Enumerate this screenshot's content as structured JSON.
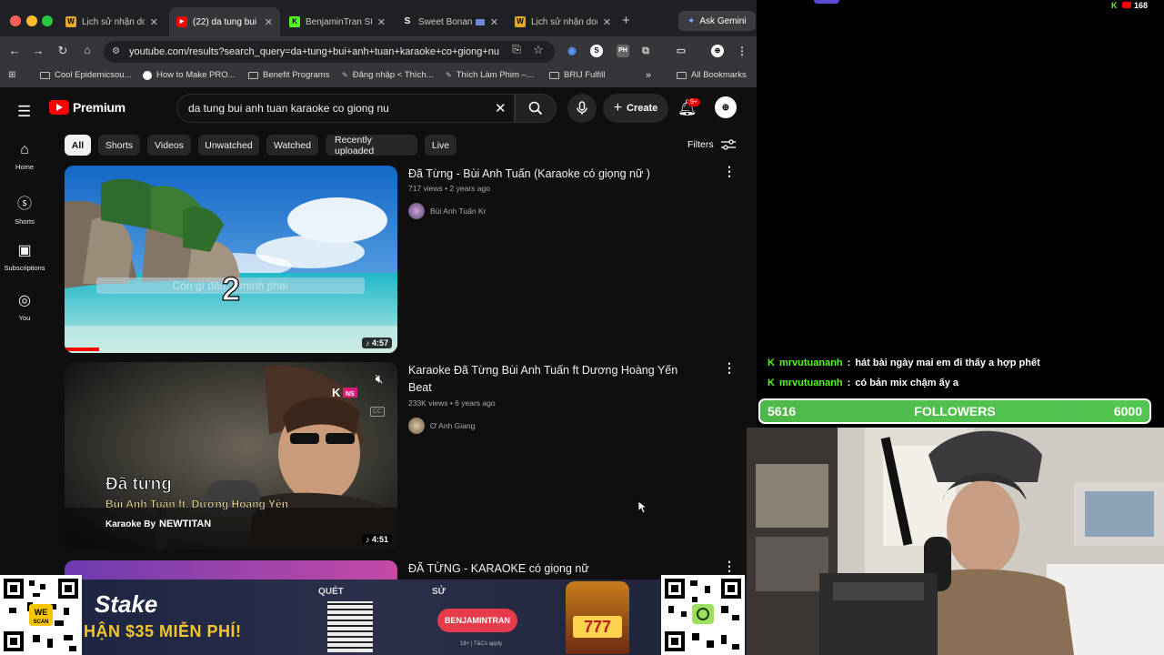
{
  "tabs": [
    {
      "label": "Lịch sử nhận don",
      "fav": "W",
      "fav_color": "#e3a72f"
    },
    {
      "label": "(22) da tung bui",
      "fav": "▶",
      "fav_color": "#ff0000"
    },
    {
      "label": "BenjaminTran St",
      "fav": "K",
      "fav_color": "#53fc18"
    },
    {
      "label": "Sweet Bonan",
      "fav": "S",
      "fav_color": "#202124"
    },
    {
      "label": "Lịch sử nhận don",
      "fav": "W",
      "fav_color": "#e3a72f"
    }
  ],
  "gemini": "Ask Gemini",
  "url": "youtube.com/results?search_query=da+tung+bui+anh+tuan+karaoke+co+giong+nu",
  "bookmarks": [
    "Cool Epidemicsou...",
    "How to Make PRO...",
    "Benefit Programs",
    "Đăng nhập < Thích...",
    "Thích Làm Phim –...",
    "BRIJ Fulfill",
    "All Bookmarks"
  ],
  "yt": {
    "logo_text": "Premium",
    "search_value": "da tung bui anh tuan karaoke co giong nu",
    "create": "Create",
    "badge": "9+",
    "sidebar": [
      "Home",
      "Shorts",
      "Subscriptions",
      "You"
    ],
    "chips": [
      "All",
      "Shorts",
      "Videos",
      "Unwatched",
      "Watched",
      "Recently uploaded",
      "Live"
    ],
    "filters": "Filters",
    "videos": [
      {
        "title": "Đã Từng - Bùi Anh Tuấn (Karaoke có giọng nữ )",
        "views": "717 views",
        "age": "2 years ago",
        "channel": "Bùi Anh Tuấn Kr",
        "duration": "4:57"
      },
      {
        "title": "Karaoke Đã Từng Bùi Anh Tuấn ft Dương Hoàng Yến Beat",
        "views": "233K views",
        "age": "6 years ago",
        "channel": "Ơ Anh Giang",
        "duration": "4:51"
      },
      {
        "title": "ĐÃ TỪNG - KARAOKE có giọng nữ"
      }
    ],
    "thumb1_number": "2",
    "thumb1_lyric": "Còn gì đâu… mình phai",
    "thumb2": {
      "title": "Đã từng",
      "sub": "Bùi Anh Tuấn ft. Dương Hoàng Yến",
      "by": "Karaoke By",
      "brand": "NEWTITAN",
      "logo": "K",
      "logo2": "NS"
    }
  },
  "status": {
    "count": "168"
  },
  "chat": [
    {
      "user": "mrvutuananh",
      "msg": "hát bài ngày mai em đi thấy a hợp phết"
    },
    {
      "user": "mrvutuananh",
      "msg": "có bản mix chậm ấy a"
    }
  ],
  "followers": {
    "current": "5616",
    "label": "FOLLOWERS",
    "goal": "6000"
  },
  "ad": {
    "brand": "Stake",
    "promo": "HẬN $35 MIỄN PHÍ!",
    "quet": "QUÉT",
    "su": "SỬ",
    "code": "BENJAMINTRAN",
    "tc": "18+ | T&Cs apply",
    "slot": "777",
    "we": "WE",
    "scan": "SCAN"
  }
}
